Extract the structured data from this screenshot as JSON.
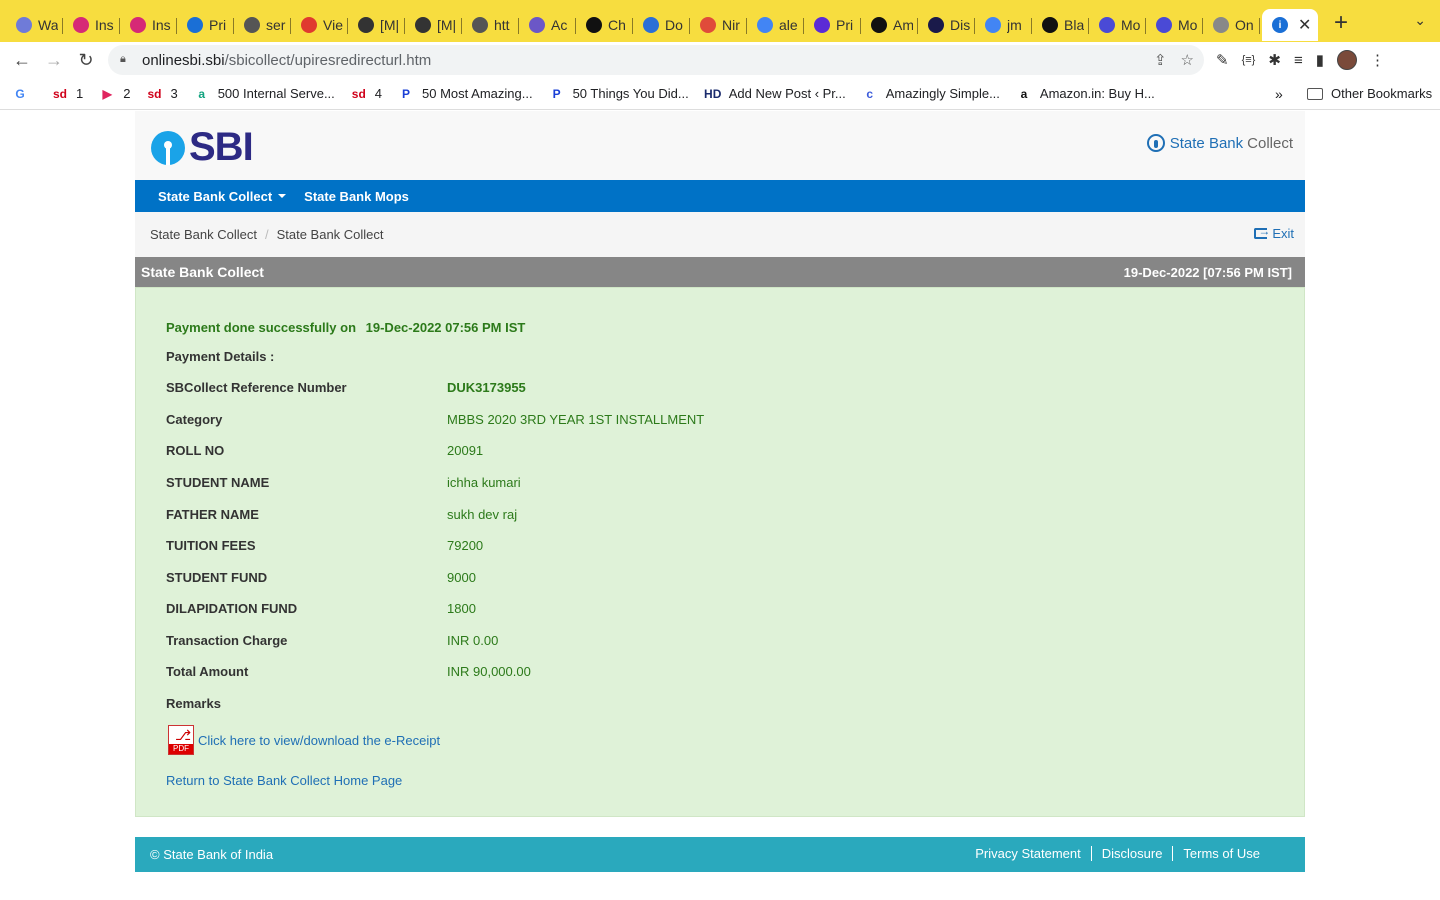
{
  "browser": {
    "tabs": [
      {
        "title": "Wa",
        "icon": "gem-icon",
        "color": "#6f7bd8"
      },
      {
        "title": "Ins",
        "icon": "instagram-icon",
        "color": "#d62976"
      },
      {
        "title": "Ins",
        "icon": "instagram-icon",
        "color": "#d62976"
      },
      {
        "title": "Pri",
        "icon": "play-icon",
        "color": "#1a6fd6"
      },
      {
        "title": "ser",
        "icon": "globe-icon",
        "color": "#555555"
      },
      {
        "title": "Vie",
        "icon": "u-icon",
        "color": "#e03a2f"
      },
      {
        "title": "[M|",
        "icon": "tent-icon",
        "color": "#333333"
      },
      {
        "title": "[M|",
        "icon": "tent-icon",
        "color": "#333333"
      },
      {
        "title": "htt",
        "icon": "globe-icon",
        "color": "#555555"
      },
      {
        "title": "Ac",
        "icon": "s-icon",
        "color": "#6b57c7"
      },
      {
        "title": "Ch",
        "icon": "d-icon",
        "color": "#111111"
      },
      {
        "title": "Do",
        "icon": "download-icon",
        "color": "#2b6fd6"
      },
      {
        "title": "Nir",
        "icon": "pinwheel-icon",
        "color": "#e04b3a"
      },
      {
        "title": "ale",
        "icon": "google-icon",
        "color": "#4285f4"
      },
      {
        "title": "Pri",
        "icon": "bars-icon",
        "color": "#5b2bd6"
      },
      {
        "title": "Am",
        "icon": "amazon-icon",
        "color": "#111111"
      },
      {
        "title": "Dis",
        "icon": "dh-icon",
        "color": "#1a1a4a"
      },
      {
        "title": "jm",
        "icon": "google-icon",
        "color": "#4285f4"
      },
      {
        "title": "Bla",
        "icon": "globe-icon",
        "color": "#111111"
      },
      {
        "title": "Mo",
        "icon": "mo-icon",
        "color": "#4a4ad6"
      },
      {
        "title": "Mo",
        "icon": "mo-icon",
        "color": "#4a4ad6"
      },
      {
        "title": "On",
        "icon": "lamp-icon",
        "color": "#888888"
      }
    ],
    "url_host": "onlinesbi.sbi",
    "url_path": "/sbicollect/upiresredirecturl.htm",
    "bookmarks": [
      {
        "label": "",
        "icon": "google-icon"
      },
      {
        "label": "1",
        "icon": "sd-icon"
      },
      {
        "label": "2",
        "icon": "red-badge-icon"
      },
      {
        "label": "3",
        "icon": "sd-icon"
      },
      {
        "label": "500 Internal Serve...",
        "icon": "teal-a-icon"
      },
      {
        "label": "4",
        "icon": "sd-icon"
      },
      {
        "label": "50 Most Amazing...",
        "icon": "p-icon"
      },
      {
        "label": "50 Things You Did...",
        "icon": "p-icon"
      },
      {
        "label": "Add New Post ‹ Pr...",
        "icon": "hd-icon"
      },
      {
        "label": "Amazingly Simple...",
        "icon": "circle-c-icon"
      },
      {
        "label": "Amazon.in: Buy H...",
        "icon": "amazon-icon"
      }
    ],
    "bookmarks_more": "»",
    "other_bookmarks": "Other Bookmarks"
  },
  "header": {
    "logo_text": "SBI",
    "brand_part1": "State Bank",
    "brand_part2": "Collect"
  },
  "nav": {
    "items": [
      "State Bank Collect",
      "State Bank Mops"
    ]
  },
  "breadcrumb": {
    "items": [
      "State Bank Collect",
      "State Bank Collect"
    ],
    "separator": "/",
    "exit_label": "Exit"
  },
  "panel": {
    "title": "State Bank Collect",
    "datetime": "19-Dec-2022 [07:56 PM IST]"
  },
  "payment": {
    "success_text": "Payment done successfully on",
    "success_date": "19-Dec-2022 07:56 PM IST",
    "details_label": "Payment Details :",
    "rows": [
      {
        "key": "SBCollect Reference Number",
        "value": "DUK3173955"
      },
      {
        "key": "Category",
        "value": "MBBS 2020 3RD YEAR 1ST INSTALLMENT"
      },
      {
        "key": "ROLL NO",
        "value": "20091"
      },
      {
        "key": "STUDENT NAME",
        "value": "ichha kumari"
      },
      {
        "key": "FATHER NAME",
        "value": "sukh dev raj"
      },
      {
        "key": "TUITION FEES",
        "value": "79200"
      },
      {
        "key": "STUDENT FUND",
        "value": "9000"
      },
      {
        "key": "DILAPIDATION FUND",
        "value": "1800"
      },
      {
        "key": "Transaction Charge",
        "value": "INR 0.00"
      },
      {
        "key": "Total Amount",
        "value": "INR 90,000.00"
      },
      {
        "key": "Remarks",
        "value": ""
      }
    ],
    "pdf_tag": "PDF",
    "receipt_link": "Click here to view/download the e-Receipt",
    "home_link": "Return to State Bank Collect Home Page"
  },
  "footer": {
    "copyright": "© State Bank of India",
    "links": [
      "Privacy Statement",
      "Disclosure",
      "Terms of Use"
    ]
  },
  "colors": {
    "nav_blue": "#0072c6",
    "success_green": "#2c7a1a",
    "panel_bg": "#dff2d8",
    "footer_teal": "#2aa9bd",
    "link_blue": "#1f6fb5"
  }
}
